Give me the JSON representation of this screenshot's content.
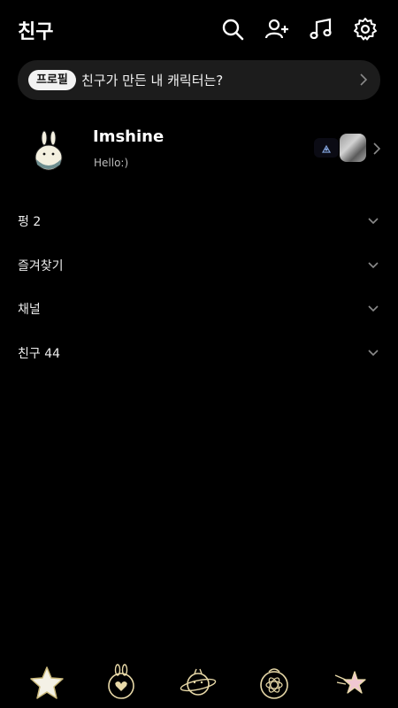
{
  "header": {
    "title": "친구",
    "icons": [
      "search-icon",
      "add-friend-icon",
      "music-icon",
      "settings-icon"
    ]
  },
  "banner": {
    "tag": "프로필",
    "text": "친구가 만든 내 캐릭터는?"
  },
  "profile": {
    "name": "Imshine",
    "status": "Hello:)"
  },
  "sections": [
    {
      "label": "펑 2"
    },
    {
      "label": "즐겨찾기"
    },
    {
      "label": "채널"
    },
    {
      "label": "친구 44"
    }
  ],
  "tabs": [
    "friends-star-icon",
    "chat-bunny-icon",
    "openchat-planet-icon",
    "shopping-atom-icon",
    "more-shooting-star-icon"
  ],
  "colors": {
    "background": "#000000",
    "banner_bg": "#1c1c1c",
    "accent_gold": "#e8d9a8",
    "text": "#ffffff"
  }
}
